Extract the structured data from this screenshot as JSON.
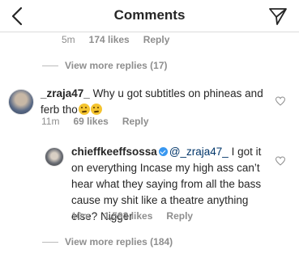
{
  "header": {
    "title": "Comments"
  },
  "top_reply_meta": {
    "time": "5m",
    "likes": "174 likes",
    "reply": "Reply"
  },
  "view_more_1": "View more replies (17)",
  "comment1": {
    "username": "_zraja47_",
    "text": " Why u got subtitles on phineas and ferb tho",
    "time": "11m",
    "likes": "69 likes",
    "reply": "Reply"
  },
  "reply1": {
    "username": "chieffkeeffsossa",
    "mention": "@_zraja47_",
    "text": " I got it on everything Incase my high ass can’t hear what they saying from all the bass  cause my shit like a theatre anything else? Nigger",
    "time": "10m",
    "likes": "1,593 likes",
    "reply": "Reply"
  },
  "view_more_2": "View more replies (184)",
  "icons": {
    "back": "chevron-left-icon",
    "send": "paper-plane-icon",
    "like": "heart-outline-icon",
    "verified": "verified-badge-icon",
    "emoji": "grimacing-face-emoji"
  },
  "colors": {
    "mention": "#003569",
    "muted": "#8e8e8e",
    "verified": "#3897f0"
  }
}
